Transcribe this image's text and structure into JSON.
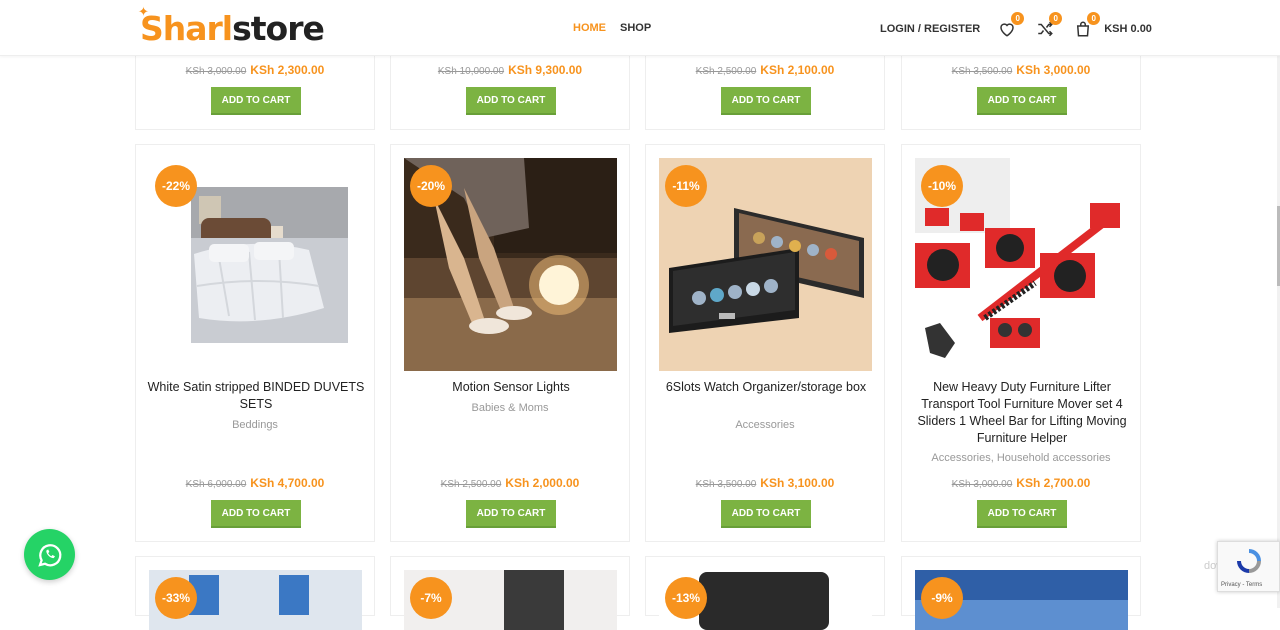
{
  "header": {
    "logo_part1": "Sharl",
    "logo_part2": "store",
    "nav": [
      "HOME",
      "SHOP"
    ],
    "login": "LOGIN / REGISTER",
    "wishlist_count": "0",
    "compare_count": "0",
    "cart_count": "0",
    "cart_total": "KSH 0.00",
    "accent": "#f7931e"
  },
  "add_to_cart": "ADD TO CART",
  "row1": [
    {
      "old": "KSh 3,000.00",
      "new": "KSh 2,300.00"
    },
    {
      "old": "KSh 10,000.00",
      "new": "KSh 9,300.00"
    },
    {
      "old": "KSh 2,500.00",
      "new": "KSh 2,100.00"
    },
    {
      "old": "KSh 3,500.00",
      "new": "KSh 3,000.00"
    }
  ],
  "row2": [
    {
      "discount": "-22%",
      "title": "White Satin stripped BINDED DUVETS SETS",
      "category": "Beddings",
      "old": "KSh 6,000.00",
      "new": "KSh 4,700.00"
    },
    {
      "discount": "-20%",
      "title": "Motion Sensor Lights",
      "category": "Babies & Moms",
      "old": "KSh 2,500.00",
      "new": "KSh 2,000.00"
    },
    {
      "discount": "-11%",
      "title": "6Slots Watch Organizer/storage box",
      "category": "Accessories",
      "old": "KSh 3,500.00",
      "new": "KSh 3,100.00"
    },
    {
      "discount": "-10%",
      "title": "New Heavy Duty Furniture Lifter Transport Tool Furniture Mover set 4 Sliders 1 Wheel Bar for Lifting Moving Furniture Helper",
      "category": "Accessories, Household accessories",
      "old": "KSh 3,000.00",
      "new": "KSh 2,700.00"
    }
  ],
  "row3": [
    {
      "discount": "-33%"
    },
    {
      "discount": "-7%"
    },
    {
      "discount": "-13%"
    },
    {
      "discount": "-9%"
    }
  ],
  "recaptcha_links": "Privacy - Terms",
  "watermark": "dows"
}
